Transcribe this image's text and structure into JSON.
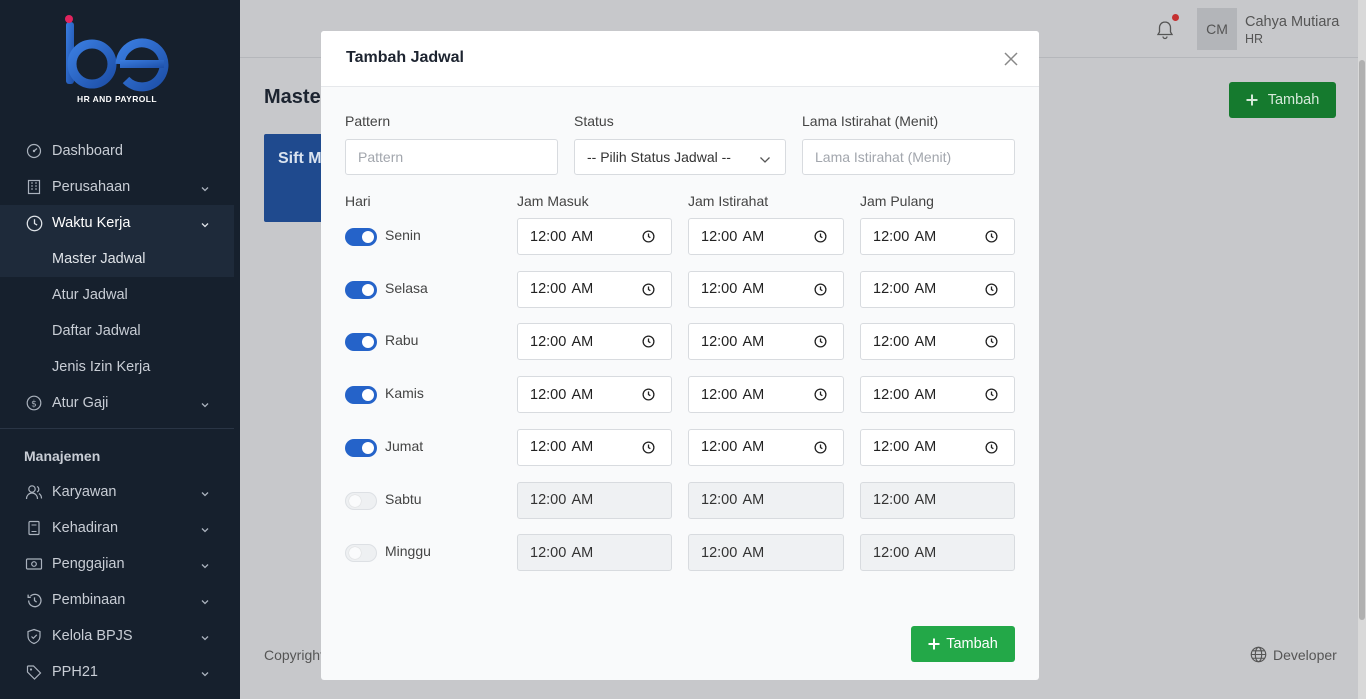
{
  "brand": {
    "logo_text": "HR AND PAYROLL",
    "colors": {
      "primary": "#2a6ad2",
      "accent": "#e0245e"
    }
  },
  "sidebar": {
    "items": [
      {
        "label": "Dashboard",
        "icon": "dashboard-icon"
      },
      {
        "label": "Perusahaan",
        "icon": "building-icon"
      },
      {
        "label": "Waktu Kerja",
        "icon": "clock-icon"
      },
      {
        "label": "Atur Gaji",
        "icon": "dollar-icon"
      }
    ],
    "sub_items": [
      "Master Jadwal",
      "Atur Jadwal",
      "Daftar Jadwal",
      "Jenis Izin Kerja"
    ],
    "section": "Manajemen",
    "section_items": [
      {
        "label": "Karyawan",
        "icon": "users-icon"
      },
      {
        "label": "Kehadiran",
        "icon": "book-icon"
      },
      {
        "label": "Penggajian",
        "icon": "cash-icon"
      },
      {
        "label": "Pembinaan",
        "icon": "history-icon"
      },
      {
        "label": "Kelola BPJS",
        "icon": "shield-icon"
      },
      {
        "label": "PPH21",
        "icon": "tag-icon"
      }
    ]
  },
  "header": {
    "avatar": "CM",
    "user_name": "Cahya Mutiara",
    "user_role": "HR"
  },
  "main": {
    "page_title": "Maste",
    "card_title": "Sift M",
    "add_label": "Tambah",
    "copyright": "Copyright",
    "developer": "Developer"
  },
  "modal": {
    "title": "Tambah Jadwal",
    "pattern_label": "Pattern",
    "pattern_placeholder": "Pattern",
    "status_label": "Status",
    "status_value": "-- Pilih Status Jadwal --",
    "break_label": "Lama Istirahat (Menit)",
    "break_placeholder": "Lama Istirahat (Menit)",
    "col_day": "Hari",
    "col_in": "Jam Masuk",
    "col_break": "Jam Istirahat",
    "col_out": "Jam Pulang",
    "days": [
      {
        "name": "Senin",
        "enabled": true,
        "in": "12:00 AM",
        "break": "12:00 AM",
        "out": "12:00 AM"
      },
      {
        "name": "Selasa",
        "enabled": true,
        "in": "12:00 AM",
        "break": "12:00 AM",
        "out": "12:00 AM"
      },
      {
        "name": "Rabu",
        "enabled": true,
        "in": "12:00 AM",
        "break": "12:00 AM",
        "out": "12:00 AM"
      },
      {
        "name": "Kamis",
        "enabled": true,
        "in": "12:00 AM",
        "break": "12:00 AM",
        "out": "12:00 AM"
      },
      {
        "name": "Jumat",
        "enabled": true,
        "in": "12:00 AM",
        "break": "12:00 AM",
        "out": "12:00 AM"
      },
      {
        "name": "Sabtu",
        "enabled": false,
        "in": "12:00 AM",
        "break": "12:00 AM",
        "out": "12:00 AM"
      },
      {
        "name": "Minggu",
        "enabled": false,
        "in": "12:00 AM",
        "break": "12:00 AM",
        "out": "12:00 AM"
      }
    ],
    "submit_label": "Tambah"
  }
}
